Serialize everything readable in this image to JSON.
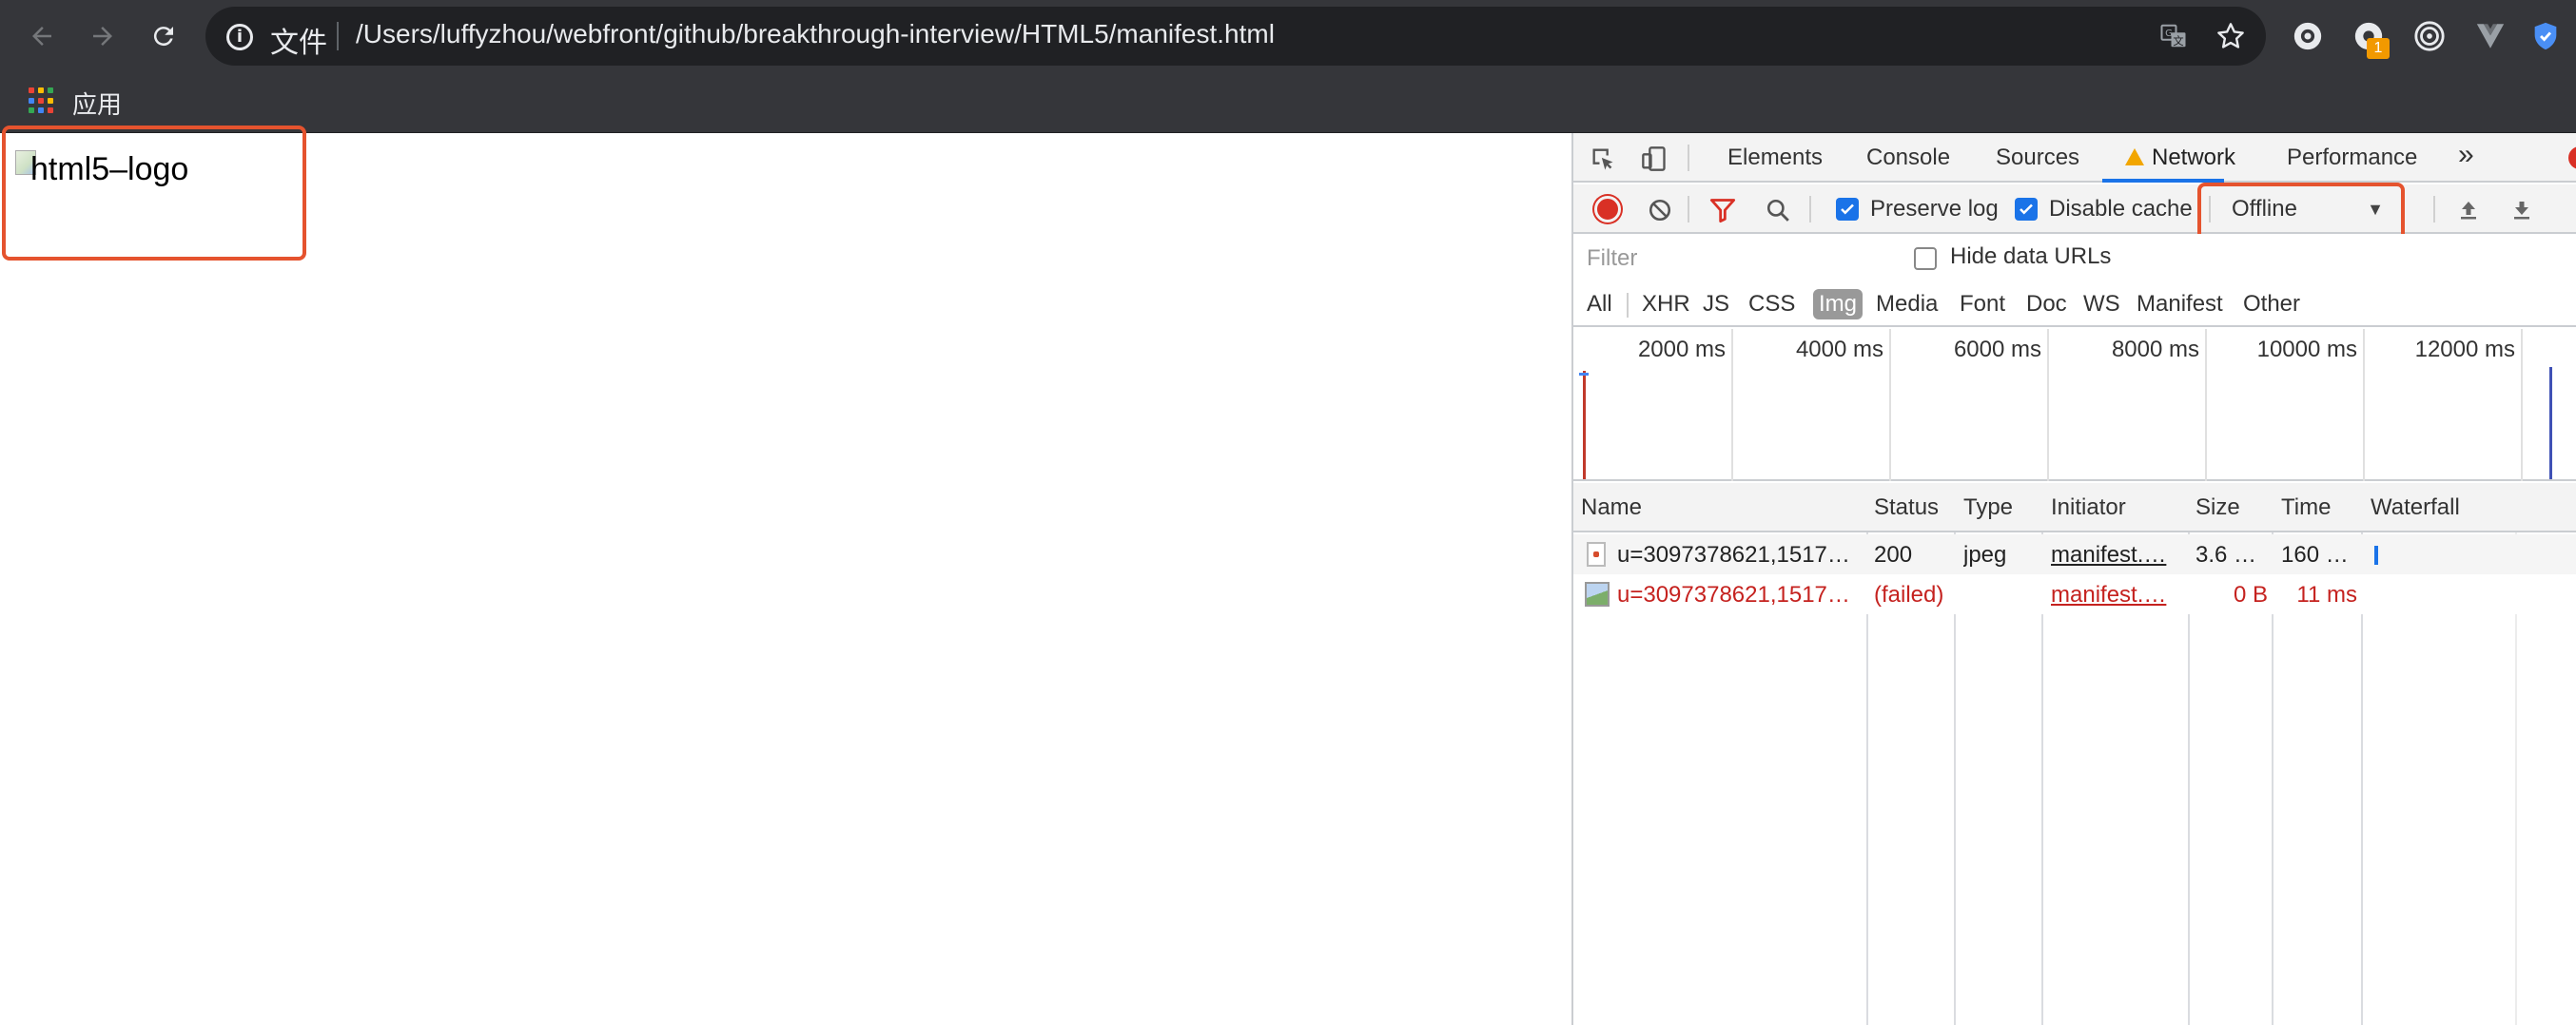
{
  "browser": {
    "omnibox": {
      "scheme_label": "文件",
      "url": "/Users/luffyzhou/webfront/github/breakthrough-interview/HTML5/manifest.html"
    },
    "extension_badge": "1",
    "bookmarks_bar": {
      "apps_label": "应用"
    }
  },
  "page": {
    "broken_image_alt": "html5–logo"
  },
  "devtools": {
    "tabs": [
      {
        "label": "Elements"
      },
      {
        "label": "Console"
      },
      {
        "label": "Sources"
      },
      {
        "label": "Network",
        "active": true,
        "warning": true
      },
      {
        "label": "Performance"
      }
    ],
    "more_tabs": "»",
    "network": {
      "preserve_log": {
        "label": "Preserve log",
        "checked": true
      },
      "disable_cache": {
        "label": "Disable cache",
        "checked": true
      },
      "throttling": {
        "value": "Offline"
      },
      "filter_placeholder": "Filter",
      "hide_data_urls": {
        "label": "Hide data URLs",
        "checked": false
      },
      "type_filters": [
        "All",
        "XHR",
        "JS",
        "CSS",
        "Img",
        "Media",
        "Font",
        "Doc",
        "WS",
        "Manifest",
        "Other"
      ],
      "active_type": "Img",
      "overview_ticks": [
        "2000 ms",
        "4000 ms",
        "6000 ms",
        "8000 ms",
        "10000 ms",
        "12000 ms"
      ],
      "columns": [
        "Name",
        "Status",
        "Type",
        "Initiator",
        "Size",
        "Time",
        "Waterfall"
      ],
      "rows": [
        {
          "name": "u=3097378621,1517…",
          "status": "200",
          "type": "jpeg",
          "initiator": "manifest.…",
          "size": "3.6 …",
          "time": "160 …",
          "failed": false
        },
        {
          "name": "u=3097378621,1517…",
          "status": "(failed)",
          "type": "",
          "initiator": "manifest.…",
          "size": "0 B",
          "time": "11 ms",
          "failed": true
        }
      ]
    }
  },
  "colors": {
    "highlight_box": "#e5532e",
    "error_text": "#c5221f",
    "record_button": "#d93025",
    "checkbox": "#1a73e8"
  }
}
